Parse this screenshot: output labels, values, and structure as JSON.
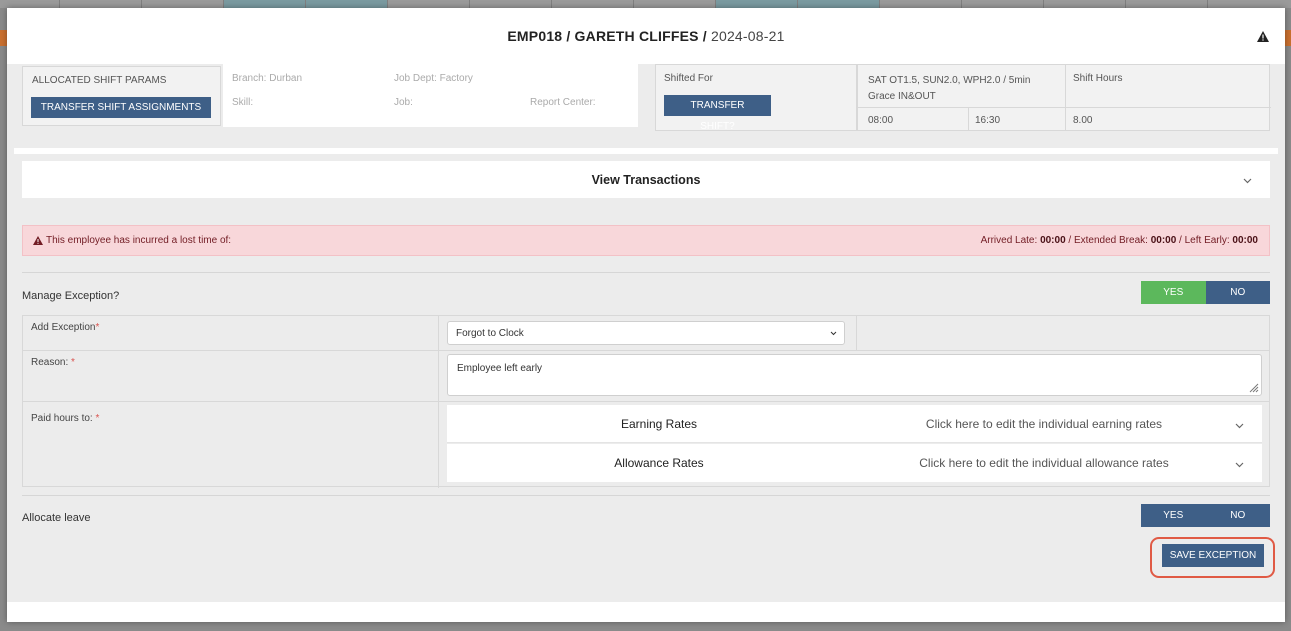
{
  "header": {
    "employee": "EMP018 / GARETH CLIFFES /",
    "date": "2024-08-21"
  },
  "params": {
    "allocated_label": "ALLOCATED SHIFT PARAMS",
    "transfer_assignments_label": "TRANSFER SHIFT ASSIGNMENTS",
    "branch": "Branch: Durban",
    "job_dept": "Job Dept: Factory",
    "skill": "Skill:",
    "job": "Job:",
    "report_center": "Report Center:",
    "shifted_for": "Shifted For",
    "transfer_shift_label": "TRANSFER SHIFT?",
    "shift_desc": "SAT OT1.5, SUN2.0, WPH2.0 / 5min Grace IN&OUT",
    "start_time": "08:00",
    "end_time": "16:30",
    "shift_hours_label": "Shift Hours",
    "shift_hours": "8.00"
  },
  "transactions": {
    "title": "View Transactions"
  },
  "alert": {
    "message": "This employee has incurred a lost time of:",
    "arrived_late_label": "Arrived Late: ",
    "arrived_late": "00:00",
    "extended_break_label": " / Extended Break: ",
    "extended_break": "00:00",
    "left_early_label": " / Left Early: ",
    "left_early": "00:00"
  },
  "manage": {
    "label": "Manage Exception?",
    "yes": "YES",
    "no": "NO"
  },
  "form": {
    "add_exception_label": "Add Exception",
    "exception_value": "Forgot to Clock",
    "reason_label": "Reason: ",
    "reason_value": "Employee left early",
    "paid_hours_label": "Paid hours to: ",
    "required_mark": "*",
    "earning_rates": "Earning Rates",
    "earning_hint": "Click here to edit the individual earning rates",
    "allowance_rates": "Allowance Rates",
    "allowance_hint": "Click here to edit the individual allowance rates"
  },
  "leave": {
    "label": "Allocate leave",
    "yes": "YES",
    "no": "NO"
  },
  "actions": {
    "save_label": "SAVE EXCEPTION"
  },
  "colors": {
    "primary": "#3e5f87",
    "success": "#5cb85c",
    "alert_bg": "#f8d7da",
    "highlight": "#e05a45"
  }
}
